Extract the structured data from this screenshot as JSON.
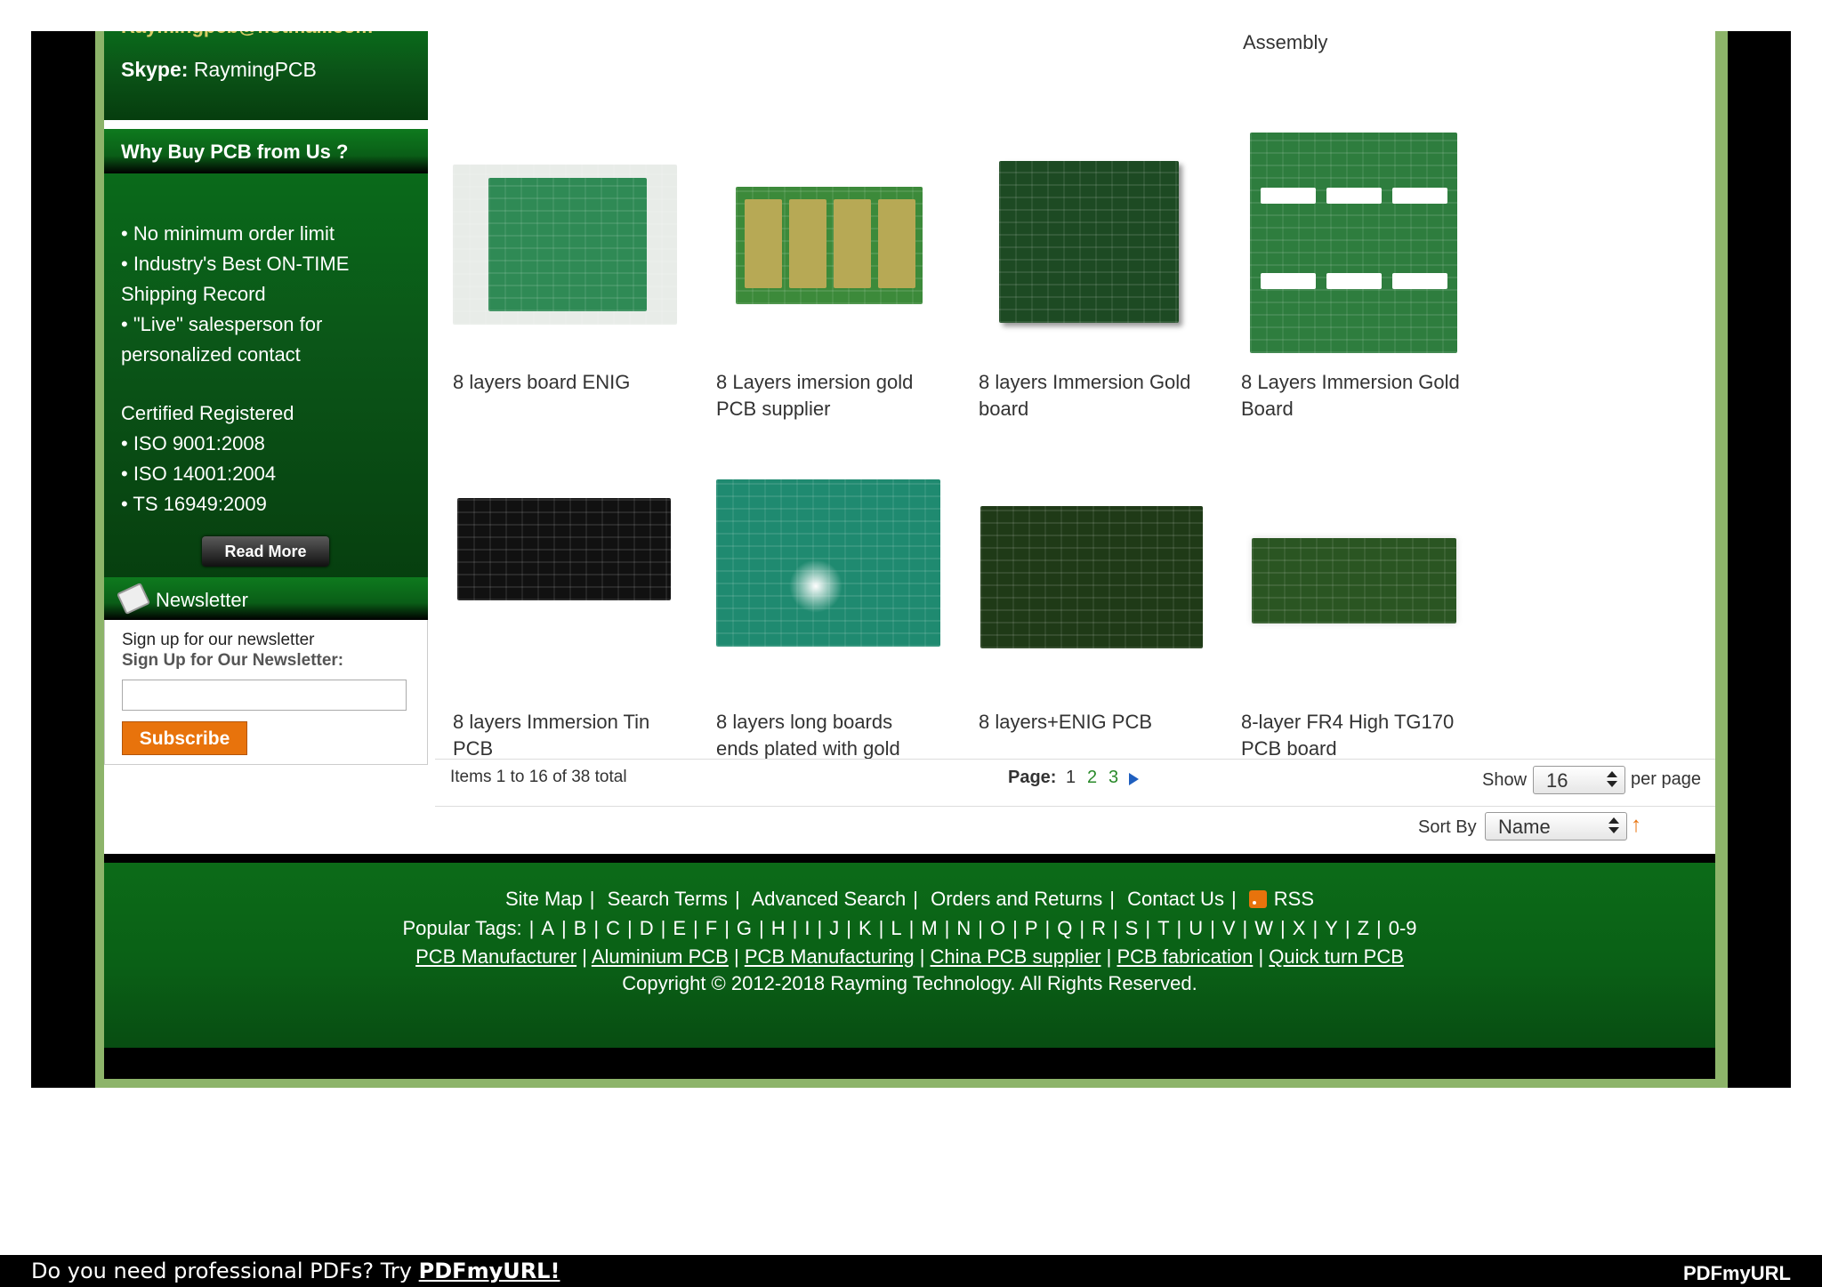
{
  "sidebar": {
    "msn_value": "Raymingpcb@hotmail.com",
    "skype_label": "Skype:",
    "skype_value": "RaymingPCB",
    "why_title": "Why Buy PCB from Us ?",
    "why_lines": [
      "• No minimum order limit",
      "• Industry's Best ON-TIME",
      "Shipping Record",
      "• \"Live\" salesperson for",
      "personalized contact",
      "Certified Registered",
      "• ISO 9001:2008",
      "• ISO 14001:2004",
      "• TS 16949:2009"
    ],
    "read_more": "Read More",
    "newsletter_title": "Newsletter",
    "newsletter_line1": "Sign up for our newsletter",
    "newsletter_line2": "Sign Up for Our Newsletter:",
    "subscribe_label": "Subscribe"
  },
  "products": {
    "top_label": "Assembly",
    "row1": [
      {
        "name_line1": "8 layers board ENIG",
        "name_line2": "",
        "color": "#2f8a55"
      },
      {
        "name_line1": "8 Layers imersion gold",
        "name_line2": "PCB supplier",
        "color": "#3c8a3a"
      },
      {
        "name_line1": "8 layers Immersion Gold",
        "name_line2": "board",
        "color": "#1d4a23"
      },
      {
        "name_line1": "8 Layers Immersion Gold",
        "name_line2": "Board",
        "color": "#2e7d3e"
      }
    ],
    "row2": [
      {
        "name_line1": "8 layers Immersion Tin",
        "name_line2": "PCB",
        "color": "#111111"
      },
      {
        "name_line1": "8 layers long boards",
        "name_line2": "ends plated with gold",
        "color": "#1f8a70"
      },
      {
        "name_line1": "8 layers+ENIG PCB",
        "name_line2": "",
        "color": "#1f3a17"
      },
      {
        "name_line1": "8-layer FR4 High TG170",
        "name_line2": "PCB board",
        "color": "#2a5522"
      }
    ]
  },
  "toolbar": {
    "items_total": "Items 1 to 16 of 38 total",
    "page_label": "Page:",
    "pages": [
      "1",
      "2",
      "3"
    ],
    "current_page": "1",
    "show_label": "Show",
    "per_page_value": "16",
    "per_page_label": "per page",
    "sort_label": "Sort By",
    "sort_value": "Name",
    "sort_direction": "↑"
  },
  "footer": {
    "links": [
      "Site Map",
      "Search Terms",
      "Advanced Search",
      "Orders and Returns",
      "Contact Us",
      "RSS"
    ],
    "tags_label": "Popular Tags:",
    "tags": [
      "A",
      "B",
      "C",
      "D",
      "E",
      "F",
      "G",
      "H",
      "I",
      "J",
      "K",
      "L",
      "M",
      "N",
      "O",
      "P",
      "Q",
      "R",
      "S",
      "T",
      "U",
      "V",
      "W",
      "X",
      "Y",
      "Z",
      "0-9"
    ],
    "seo_links": [
      "PCB Manufacturer",
      "Aluminium PCB",
      "PCB Manufacturing",
      "China PCB supplier",
      "PCB fabrication",
      "Quick turn PCB"
    ],
    "copyright": "Copyright © 2012-2018 Rayming Technology. All Rights Reserved."
  },
  "banner": {
    "text": "Do you need professional PDFs? Try",
    "link": "PDFmyURL!",
    "logo": "PDFmyURL"
  },
  "colors": {
    "footer_green": "#0a6016",
    "accent_orange": "#e8730c",
    "page_link_green": "#2a8a2a"
  }
}
